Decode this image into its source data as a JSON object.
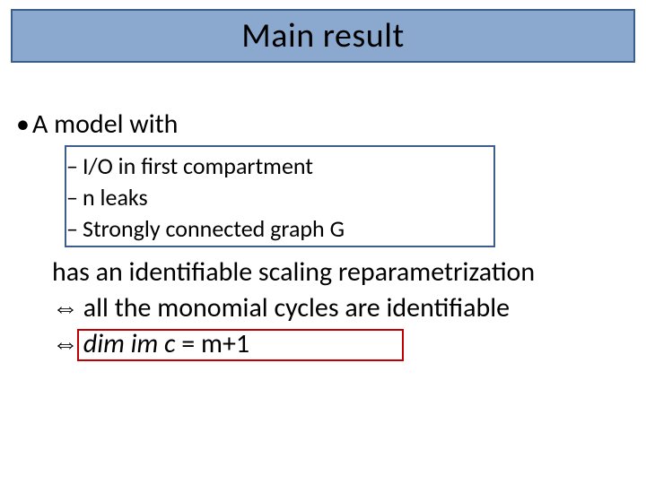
{
  "title": "Main result",
  "bullet": "A model with",
  "sub": {
    "items": [
      "I/O in first compartment",
      "n leaks",
      "Strongly connected graph G"
    ]
  },
  "body": {
    "line1": "has an identifiable scaling reparametrization",
    "line2_arrow": "⇔",
    "line2_text": " all the monomial cycles are identifiable",
    "line3_arrow": "⇔",
    "line3_prefix": " ",
    "line3_ital1": "dim im c",
    "line3_mid": " = m+1"
  }
}
